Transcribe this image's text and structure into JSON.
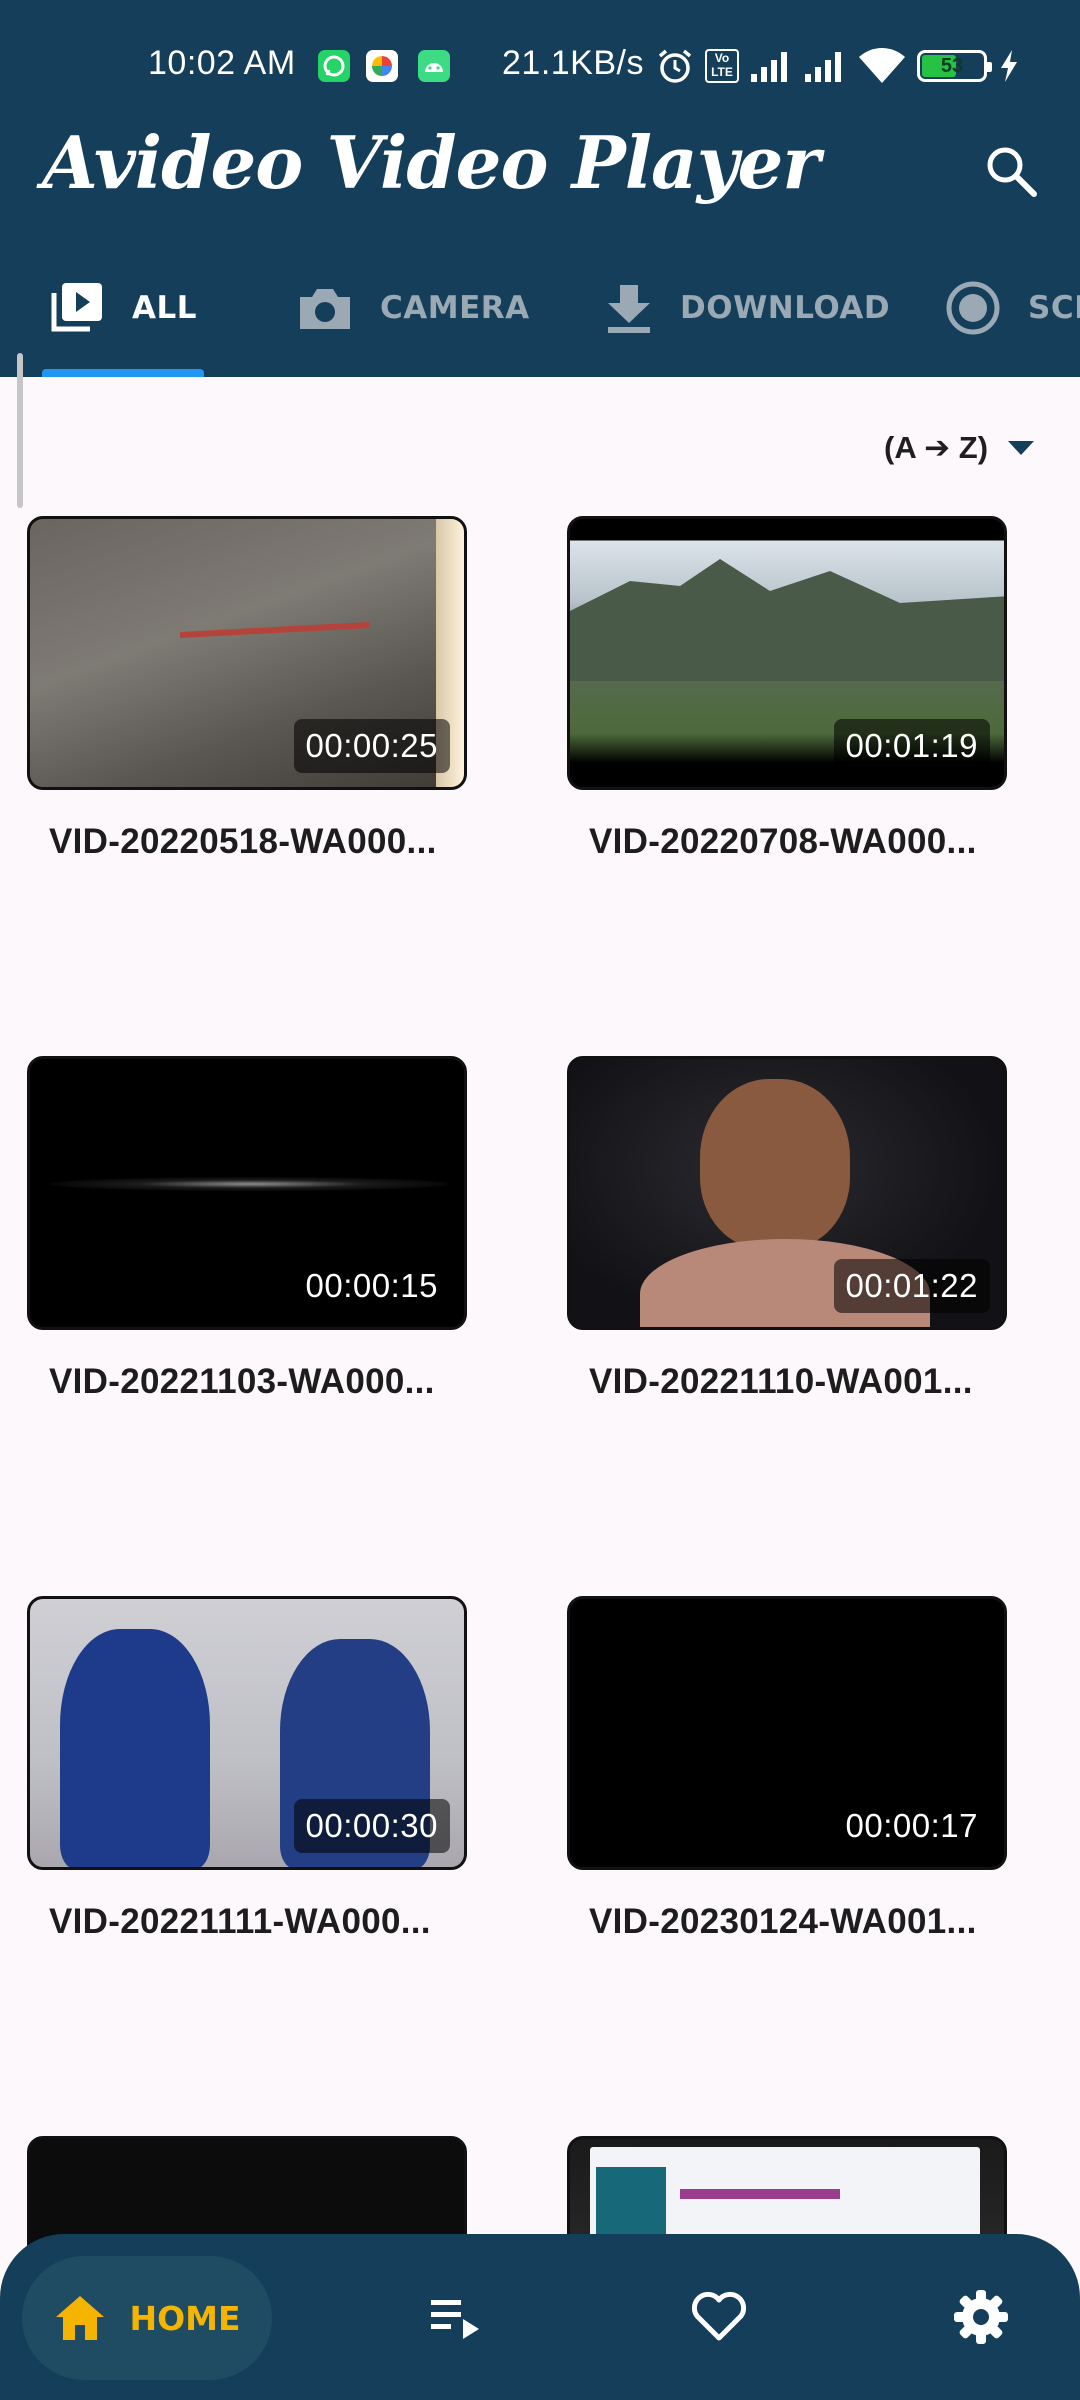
{
  "status_bar": {
    "time": "10:02 AM",
    "network_speed": "21.1KB/s",
    "battery_level": "53",
    "network_badge": "Vo LTE",
    "notification_icons": [
      "whatsapp-icon",
      "photos-icon",
      "android-icon"
    ],
    "system_icons": [
      "alarm-icon",
      "volte-icon",
      "signal-icon",
      "signal-icon",
      "wifi-icon",
      "battery-icon",
      "charging-icon"
    ]
  },
  "app_bar": {
    "title": "Avideo Video Player",
    "search_icon": "search-icon"
  },
  "tabs": [
    {
      "label": "ALL",
      "icon": "video-library-icon",
      "selected": true
    },
    {
      "label": "CAMERA",
      "icon": "camera-icon",
      "selected": false
    },
    {
      "label": "DOWNLOAD",
      "icon": "download-icon",
      "selected": false
    },
    {
      "label": "SCR",
      "icon": "record-icon",
      "selected": false
    }
  ],
  "sort": {
    "label": "(A ➔ Z)",
    "icon": "dropdown-arrow-icon"
  },
  "videos": [
    {
      "title": "VID-20220518-WA000...",
      "duration": "00:00:25"
    },
    {
      "title": "VID-20220708-WA000...",
      "duration": "00:01:19"
    },
    {
      "title": "VID-20221103-WA000...",
      "duration": "00:00:15"
    },
    {
      "title": "VID-20221110-WA001...",
      "duration": "00:01:22"
    },
    {
      "title": "VID-20221111-WA000...",
      "duration": "00:00:30"
    },
    {
      "title": "VID-20230124-WA001...",
      "duration": "00:00:17"
    }
  ],
  "bottom_nav": {
    "home_label": "HOME",
    "items": [
      "home-icon",
      "playlist-icon",
      "favorite-icon",
      "settings-icon"
    ]
  },
  "colors": {
    "primary": "#143e59",
    "accent": "#f5b400",
    "tab_indicator": "#2196f3",
    "background": "#fdf8fb"
  }
}
